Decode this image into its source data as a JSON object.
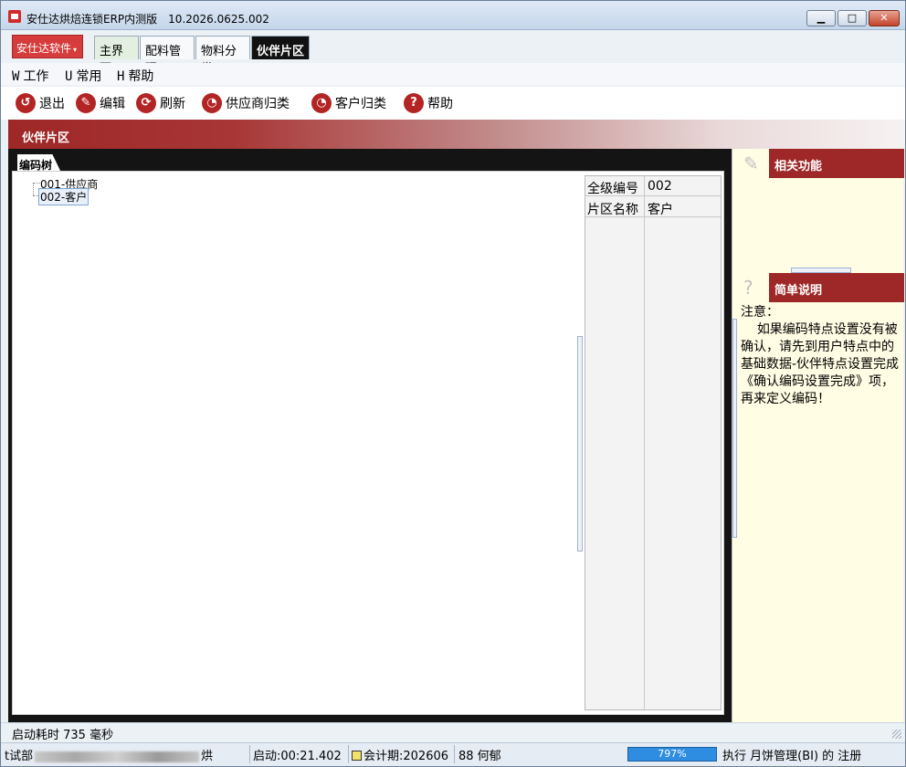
{
  "window": {
    "title": "安仕达烘焙连锁ERP内测版",
    "version": "10.2026.0625.002",
    "controls": {
      "minimize": "▁",
      "maximize": "□",
      "close": "✕"
    }
  },
  "tabs": {
    "brand_label": "安仕达软件",
    "brand_arrow": "▾",
    "items": [
      "主界面",
      "配料管理",
      "物料分类",
      "伙伴片区"
    ]
  },
  "menu": {
    "items": [
      {
        "key": "W",
        "label": "工作"
      },
      {
        "key": "U",
        "label": "常用"
      },
      {
        "key": "H",
        "label": "帮助"
      }
    ]
  },
  "toolbar": {
    "exit": "退出",
    "edit": "编辑",
    "refresh": "刷新",
    "supplier_classify": "供应商归类",
    "customer_classify": "客户归类",
    "help": "帮助",
    "icons": {
      "exit": "exit-icon",
      "edit": "edit-icon",
      "refresh": "refresh-icon",
      "supplier": "clock-icon",
      "customer": "clock-icon",
      "help": "help-icon"
    }
  },
  "section": {
    "title": "伙伴片区"
  },
  "tree": {
    "tab_label": "编码树",
    "nodes": [
      "001-供应商",
      "002-客户"
    ],
    "selected": "002-客户"
  },
  "properties": {
    "rows": [
      {
        "label": "全级编号",
        "value": "002"
      },
      {
        "label": "片区名称",
        "value": "客户"
      }
    ]
  },
  "right_panel": {
    "related_title": "相关功能",
    "brief_title": "简单说明",
    "note": "注意：\n    如果编码特点设置没有被确认，请先到用户特点中的 基础数据-伙伴特点设置完成《确认编码设置完成》项，再来定义编码！"
  },
  "status": {
    "startup": "启动耗时 735 毫秒",
    "dept_prefix": "t试部",
    "dept_suffix": "烘",
    "uptime": "启动:00:21.402",
    "period": "会计期:202606",
    "user": "88 何郁",
    "progress_percent": 79.7,
    "progress_label": "797%",
    "message": "执行 月饼管理(BI) 的 注册"
  }
}
